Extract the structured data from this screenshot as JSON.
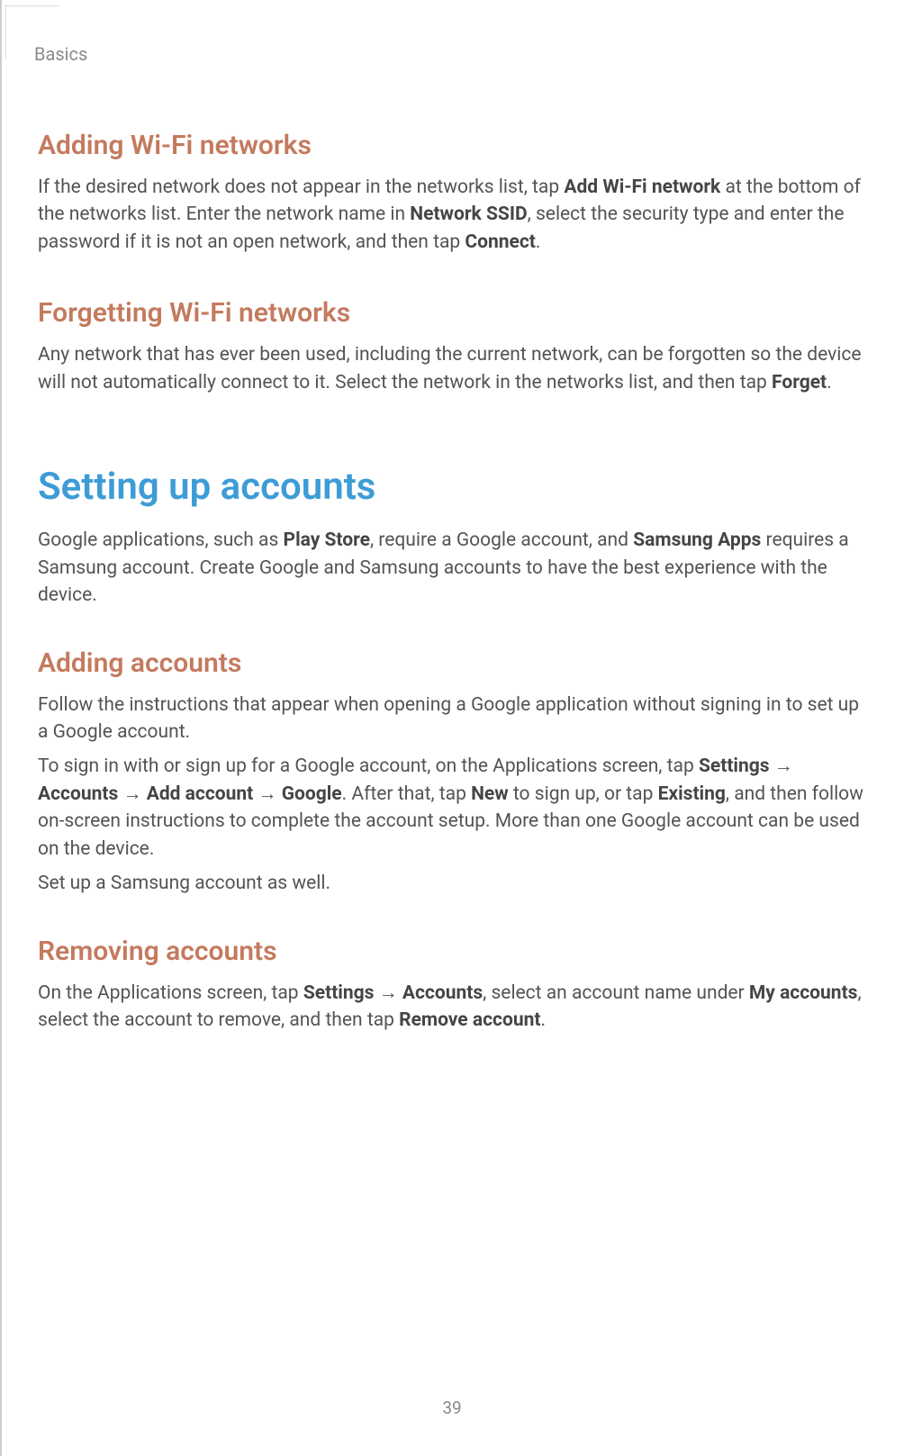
{
  "header": {
    "chapter": "Basics"
  },
  "sections": {
    "adding_wifi": {
      "title": "Adding Wi-Fi networks",
      "para1": {
        "t1": "If the desired network does not appear in the networks list, tap ",
        "b1": "Add Wi-Fi network",
        "t2": " at the bottom of the networks list. Enter the network name in ",
        "b2": "Network SSID",
        "t3": ", select the security type and enter the password if it is not an open network, and then tap ",
        "b3": "Connect",
        "t4": "."
      }
    },
    "forgetting_wifi": {
      "title": "Forgetting Wi-Fi networks",
      "para1": {
        "t1": "Any network that has ever been used, including the current network, can be forgotten so the device will not automatically connect to it. Select the network in the networks list, and then tap ",
        "b1": "Forget",
        "t2": "."
      }
    },
    "setting_accounts": {
      "title": "Setting up accounts",
      "para1": {
        "t1": "Google applications, such as ",
        "b1": "Play Store",
        "t2": ", require a Google account, and ",
        "b2": "Samsung Apps",
        "t3": " requires a Samsung account. Create Google and Samsung accounts to have the best experience with the device."
      }
    },
    "adding_accounts": {
      "title": "Adding accounts",
      "para1": "Follow the instructions that appear when opening a Google application without signing in to set up a Google account.",
      "para2": {
        "t1": "To sign in with or sign up for a Google account, on the Applications screen, tap ",
        "b1": "Settings",
        "arrow1": " → ",
        "b2": "Accounts",
        "arrow2": " → ",
        "b3": "Add account",
        "arrow3": " → ",
        "b4": "Google",
        "t2": ". After that, tap ",
        "b5": "New",
        "t3": " to sign up, or tap ",
        "b6": "Existing",
        "t4": ", and then follow on-screen instructions to complete the account setup. More than one Google account can be used on the device."
      },
      "para3": "Set up a Samsung account as well."
    },
    "removing_accounts": {
      "title": "Removing accounts",
      "para1": {
        "t1": "On the Applications screen, tap ",
        "b1": "Settings",
        "arrow1": " → ",
        "b2": "Accounts",
        "t2": ", select an account name under ",
        "b3": "My accounts",
        "t3": ", select the account to remove, and then tap ",
        "b4": "Remove account",
        "t4": "."
      }
    }
  },
  "page_number": "39"
}
